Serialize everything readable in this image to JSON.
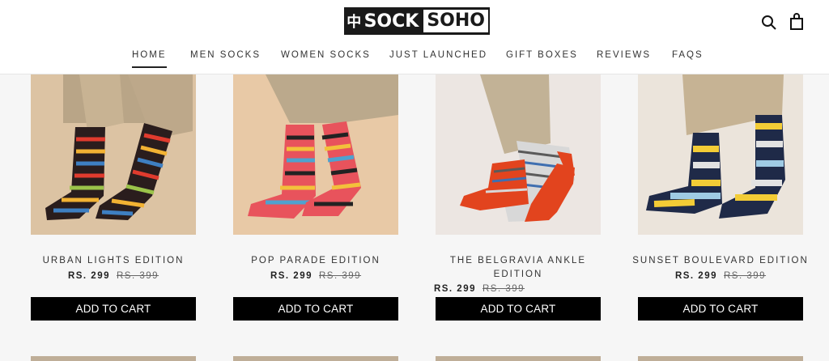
{
  "header": {
    "logo_mark": "中",
    "logo_text_1": "SOCK",
    "logo_text_2": "SOHO"
  },
  "nav": [
    {
      "label": "HOME",
      "active": true
    },
    {
      "label": "MEN SOCKS"
    },
    {
      "label": "WOMEN SOCKS"
    },
    {
      "label": "JUST LAUNCHED"
    },
    {
      "label": "GIFT BOXES"
    },
    {
      "label": "REVIEWS"
    },
    {
      "label": "FAQS"
    }
  ],
  "icons": {
    "search": "search-icon",
    "cart": "shopping-bag-icon"
  },
  "products": [
    {
      "title": "URBAN LIGHTS EDITION",
      "price": "RS. 299",
      "compare_price": "RS. 399",
      "button": "ADD TO CART"
    },
    {
      "title": "POP PARADE EDITION",
      "price": "RS. 299",
      "compare_price": "RS. 399",
      "button": "ADD TO CART"
    },
    {
      "title": "THE BELGRAVIA ANKLE EDITION",
      "price": "RS. 299",
      "compare_price": "RS. 399",
      "button": "ADD TO CART"
    },
    {
      "title": "SUNSET BOULEVARD EDITION",
      "price": "RS. 299",
      "compare_price": "RS. 399",
      "button": "ADD TO CART"
    }
  ]
}
